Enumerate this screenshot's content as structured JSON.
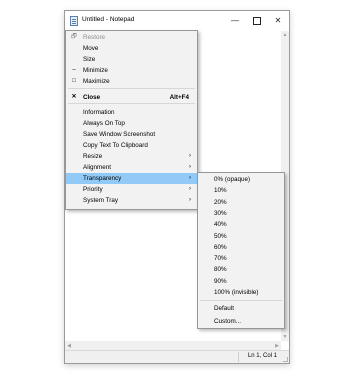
{
  "window": {
    "title": "Untitled - Notepad",
    "minimize_glyph": "—",
    "close_glyph": "✕"
  },
  "statusbar": {
    "position": "Ln 1, Col 1"
  },
  "sysmenu": {
    "items": [
      {
        "label": "Restore",
        "glyph": "🗗",
        "disabled": true
      },
      {
        "label": "Move"
      },
      {
        "label": "Size"
      },
      {
        "label": "Minimize",
        "glyph": "‒"
      },
      {
        "label": "Maximize",
        "glyph": "□"
      },
      {
        "label": "Close",
        "glyph": "✕",
        "accel": "Alt+F4",
        "bold": true
      },
      {
        "label": "Information"
      },
      {
        "label": "Always On Top"
      },
      {
        "label": "Save Window Screenshot"
      },
      {
        "label": "Copy Text To Clipboard"
      },
      {
        "label": "Resize",
        "arrow": "›"
      },
      {
        "label": "Alignment",
        "arrow": "›"
      },
      {
        "label": "Transparency",
        "arrow": "›",
        "highlighted": true
      },
      {
        "label": "Priority",
        "arrow": "›"
      },
      {
        "label": "System Tray",
        "arrow": "›"
      }
    ]
  },
  "transparency_menu": {
    "items": [
      "0% (opaque)",
      "10%",
      "20%",
      "30%",
      "40%",
      "50%",
      "60%",
      "70%",
      "80%",
      "90%",
      "100% (invisible)"
    ],
    "default_label": "Default",
    "custom_label": "Custom..."
  },
  "colors": {
    "highlight": "#91c9f7",
    "menu_bg": "#f2f2f2"
  }
}
